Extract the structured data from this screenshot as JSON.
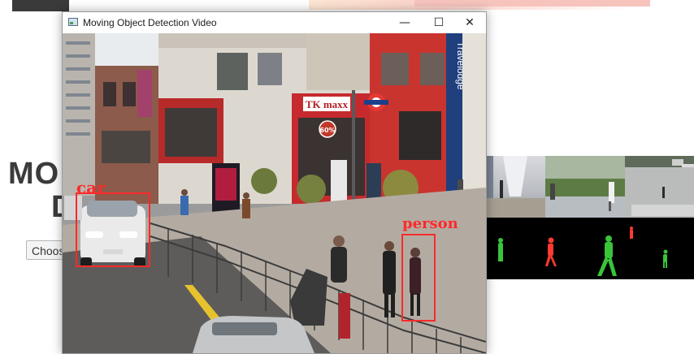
{
  "page": {
    "hero_title_line1": "MO",
    "hero_title_line2": "D",
    "choose_button_label": "Choos"
  },
  "window": {
    "title": "Moving Object Detection Video",
    "controls": {
      "minimize_icon": "minimize-icon",
      "maximize_icon": "maximize-icon",
      "close_icon": "close-icon",
      "minimize_glyph": "—",
      "maximize_glyph": "☐",
      "close_glyph": "✕"
    }
  },
  "video": {
    "store_sign": "TK maxx",
    "hotel_sign": "Travelodge",
    "poster_text": "60%",
    "detections": [
      {
        "label": "car",
        "color": "#ff2a2a"
      },
      {
        "label": "person",
        "color": "#ff2a2a"
      }
    ]
  },
  "colors": {
    "detection_box": "#ff2a2a",
    "segmentation_moving": "#ff3b30",
    "segmentation_static": "#39c43a"
  }
}
